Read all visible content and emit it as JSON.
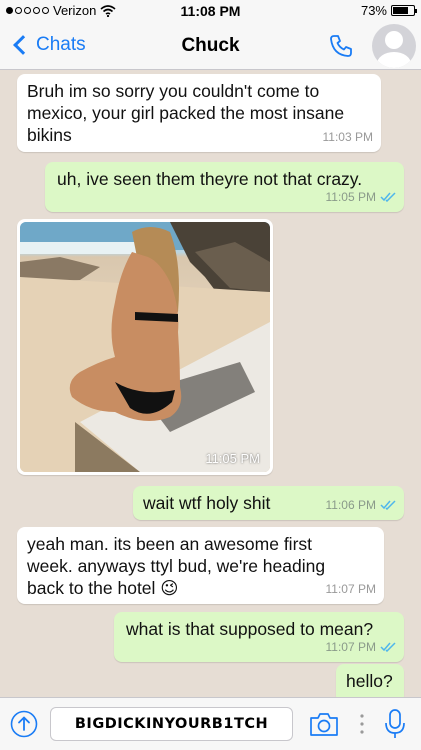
{
  "status": {
    "carrier": "Verizon",
    "time": "11:08 PM",
    "battery": "73%",
    "battery_level": 0.73
  },
  "nav": {
    "back_label": "Chats",
    "title": "Chuck"
  },
  "messages": [
    {
      "text": "Bruh im so sorry you couldn't come to mexico, your girl packed the most insane bikins",
      "time": "11:03 PM"
    },
    {
      "text": "uh, ive seen them theyre not that crazy.",
      "time": "11:05 PM"
    },
    {
      "photo_time": "11:05 PM"
    },
    {
      "text": "wait wtf holy shit",
      "time": "11:06 PM"
    },
    {
      "text": "yeah man. its been an awesome first week. anyways ttyl bud, we're heading back to the hotel 😉",
      "time": "11:07 PM"
    },
    {
      "text": "what is that supposed to mean?",
      "time": "11:07 PM"
    },
    {
      "text": "hello?",
      "time": ""
    }
  ],
  "input": {
    "value": "BIGDICKINYOURB1TCH"
  },
  "colors": {
    "accent": "#1a7cf5",
    "outgoing_bubble": "#dcf8c6",
    "incoming_bubble": "#ffffff",
    "chat_background": "#e6ddd4",
    "read_ticks": "#4fb6ec"
  },
  "icons": {
    "back": "chevron-left-icon",
    "call": "phone-icon",
    "avatar": "avatar-icon",
    "upload": "upload-icon",
    "camera": "camera-icon",
    "more": "more-vertical-icon",
    "mic": "microphone-icon",
    "read": "double-check-icon"
  }
}
